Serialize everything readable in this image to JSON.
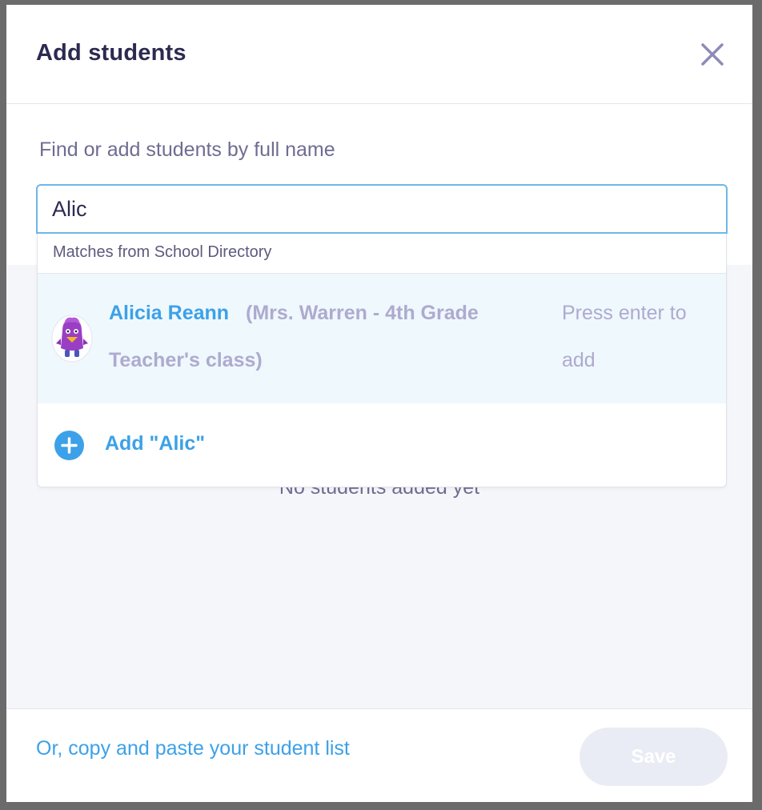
{
  "modal": {
    "title": "Add students"
  },
  "search": {
    "label": "Find or add students by full name",
    "value": "Alic"
  },
  "dropdown": {
    "header": "Matches from School Directory",
    "match": {
      "name": "Alicia Reann",
      "class": "(Mrs. Warren - 4th Grade Teacher's class)",
      "hint": "Press enter to add"
    },
    "add_label": "Add \"Alic\""
  },
  "content": {
    "empty_text": "No students added yet"
  },
  "footer": {
    "copy_link": "Or, copy and paste your student list",
    "save_label": "Save"
  },
  "colors": {
    "accent": "#3ca1e8",
    "title": "#2c2a50",
    "muted": "#aeaad0",
    "match_bg": "#eff8fc",
    "content_bg": "#f5f6fa"
  },
  "icons": {
    "close": "close-icon",
    "avatar": "monster-avatar-icon",
    "add": "plus-circle-icon"
  }
}
